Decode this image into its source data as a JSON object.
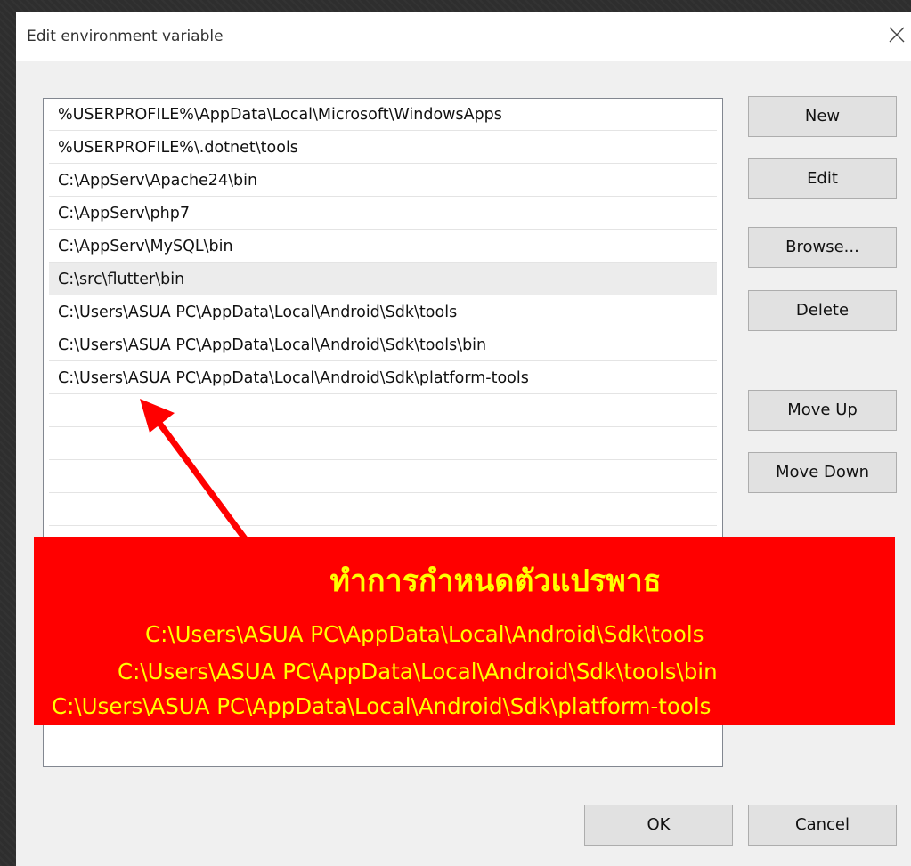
{
  "dialog": {
    "title": "Edit environment variable",
    "close_icon": "close-icon"
  },
  "list": {
    "items": [
      "%USERPROFILE%\\AppData\\Local\\Microsoft\\WindowsApps",
      "%USERPROFILE%\\.dotnet\\tools",
      "C:\\AppServ\\Apache24\\bin",
      "C:\\AppServ\\php7",
      "C:\\AppServ\\MySQL\\bin",
      "C:\\src\\flutter\\bin",
      "C:\\Users\\ASUA PC\\AppData\\Local\\Android\\Sdk\\tools",
      "C:\\Users\\ASUA PC\\AppData\\Local\\Android\\Sdk\\tools\\bin",
      "C:\\Users\\ASUA PC\\AppData\\Local\\Android\\Sdk\\platform-tools"
    ]
  },
  "buttons": {
    "new": "New",
    "edit": "Edit",
    "browse": "Browse...",
    "delete": "Delete",
    "move_up": "Move Up",
    "move_down": "Move Down",
    "ok": "OK",
    "cancel": "Cancel"
  },
  "annotation": {
    "title": "ทำการกำหนดตัวแปรพาธ",
    "lines": [
      "C:\\Users\\ASUA PC\\AppData\\Local\\Android\\Sdk\\tools",
      "C:\\Users\\ASUA PC\\AppData\\Local\\Android\\Sdk\\tools\\bin",
      "C:\\Users\\ASUA PC\\AppData\\Local\\Android\\Sdk\\platform-tools"
    ],
    "background_color": "#ff0000",
    "text_color": "#ffff00",
    "arrow_color": "#ff0000"
  }
}
